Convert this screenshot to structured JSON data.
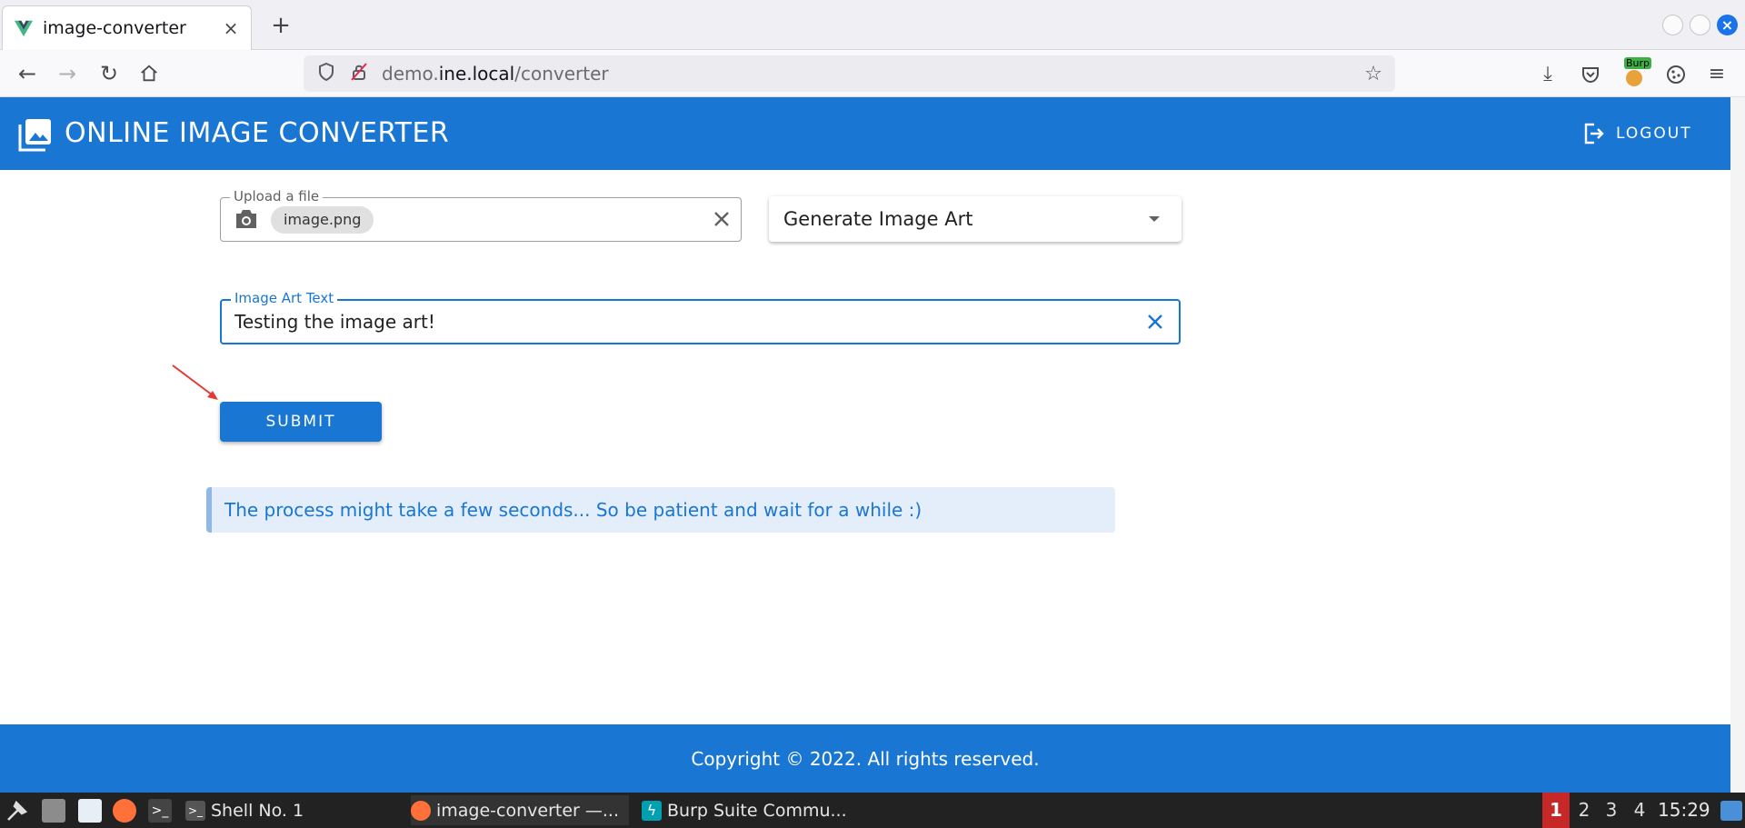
{
  "browser": {
    "tab_title": "image-converter",
    "tab_close": "×",
    "new_tab": "+",
    "url_prefix": "demo.",
    "url_host": "ine.local",
    "url_path": "/converter",
    "burp_badge": "Burp"
  },
  "app": {
    "title": "ONLINE IMAGE CONVERTER",
    "logout_label": "LOGOUT",
    "upload": {
      "label": "Upload a file",
      "file_chip": "image.png"
    },
    "select": {
      "value": "Generate Image Art"
    },
    "text_field": {
      "label": "Image Art Text",
      "value": "Testing the image art!"
    },
    "submit_label": "SUBMIT",
    "alert_text": "The process might take a few seconds... So be patient and wait for a while :)",
    "footer_text": "Copyright © 2022. All rights reserved.",
    "brand_color": "#1976d2"
  },
  "taskbar": {
    "tasks": [
      {
        "label": "Shell No. 1"
      },
      {
        "label": "image-converter —..."
      },
      {
        "label": "Burp Suite Commu..."
      }
    ],
    "workspaces": [
      "1",
      "2",
      "3",
      "4"
    ],
    "clock": "15:29"
  }
}
